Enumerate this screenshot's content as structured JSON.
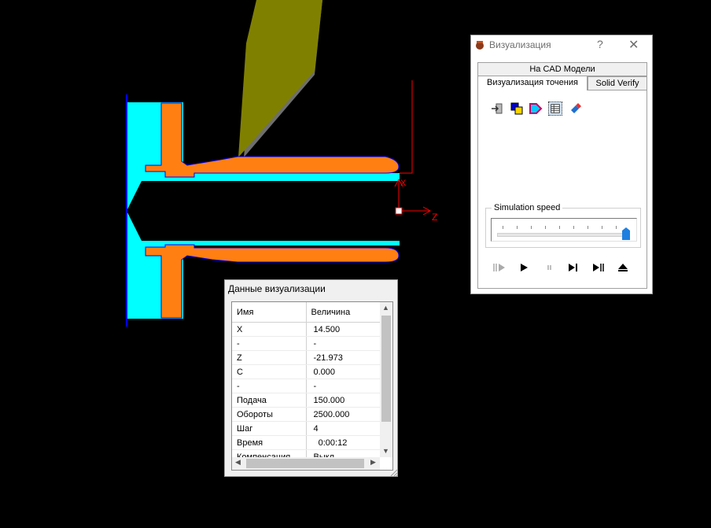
{
  "scene": {
    "axis_labels": {
      "x": "X",
      "z": "Z"
    },
    "colors": {
      "workpiece": "#ff7f13",
      "chuck": "#00ffff",
      "tool_holder": "#808000",
      "tool_body": "#6e6e6e",
      "contour": "#0000ff",
      "axis": "#ff0000"
    }
  },
  "viz_window": {
    "title": "Визуализация",
    "help_label": "?",
    "close_label": "✕",
    "tabs": [
      {
        "label": "На  CAD Модели"
      },
      {
        "label": "Визуализация точения"
      },
      {
        "label": "Solid Verify"
      }
    ],
    "toolbar_icons": [
      "enter-icon",
      "colors-icon",
      "tool-shape-icon",
      "table-icon",
      "eraser-icon"
    ],
    "speed": {
      "label": "Simulation speed",
      "value": 1.0
    },
    "controls": [
      "step-back-icon",
      "play-icon",
      "pause-icon",
      "step-forward-icon",
      "run-to-end-icon",
      "eject-icon"
    ]
  },
  "data_window": {
    "title": "Данные визуализации",
    "columns": [
      "Имя",
      "Величина"
    ],
    "rows": [
      [
        "X",
        "14.500"
      ],
      [
        "-",
        "-"
      ],
      [
        "Z",
        "-21.973"
      ],
      [
        "C",
        "0.000"
      ],
      [
        "-",
        "-"
      ],
      [
        "Подача",
        "150.000"
      ],
      [
        "Обороты",
        "2500.000"
      ],
      [
        "Шаг",
        "4"
      ],
      [
        "Время",
        "  0:00:12"
      ],
      [
        "Компенсация",
        "Выкл"
      ]
    ]
  }
}
